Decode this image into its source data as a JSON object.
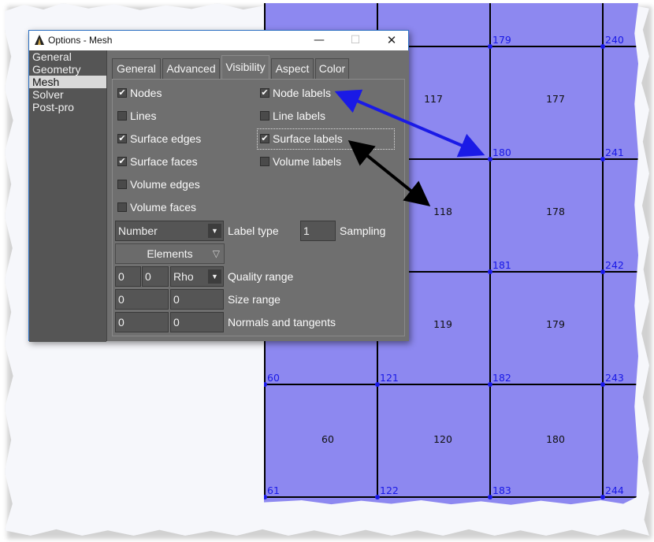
{
  "mesh": {
    "node_labels": [
      "179",
      "240",
      "180",
      "241",
      "181",
      "242",
      "60",
      "121",
      "182",
      "243",
      "61",
      "122",
      "183",
      "244"
    ],
    "element_labels": [
      "117",
      "177",
      "118",
      "178",
      "119",
      "179",
      "60",
      "120",
      "180"
    ],
    "node_color": "#1919e6",
    "face_color": "#8d88f0"
  },
  "dialog": {
    "title": "Options - Mesh",
    "title_icon": "gmsh-logo-icon",
    "controls": {
      "minimize": "—",
      "maximize": "☐",
      "close": "✕"
    },
    "categories": [
      "General",
      "Geometry",
      "Mesh",
      "Solver",
      "Post-pro"
    ],
    "selected_category": "Mesh",
    "tabs": [
      "General",
      "Advanced",
      "Visibility",
      "Aspect",
      "Color"
    ],
    "active_tab": "Visibility",
    "checkboxes": [
      {
        "label": "Nodes",
        "checked": true
      },
      {
        "label": "Lines",
        "checked": false
      },
      {
        "label": "Surface edges",
        "checked": true
      },
      {
        "label": "Surface faces",
        "checked": true
      },
      {
        "label": "Volume edges",
        "checked": false
      },
      {
        "label": "Volume faces",
        "checked": false
      },
      {
        "label": "Node labels",
        "checked": true
      },
      {
        "label": "Line labels",
        "checked": false
      },
      {
        "label": "Surface labels",
        "checked": true
      },
      {
        "label": "Volume labels",
        "checked": false
      }
    ],
    "label_type": {
      "value": "Number",
      "label": "Label type"
    },
    "sampling": {
      "value": "1",
      "label": "Sampling"
    },
    "elements_button": "Elements",
    "quality_range": {
      "min": "0",
      "max": "0",
      "measure": "Rho",
      "label": "Quality range"
    },
    "size_range": {
      "min": "0",
      "max": "0",
      "label": "Size range"
    },
    "normals": {
      "normals": "0",
      "tangents": "0",
      "label": "Normals and tangents"
    }
  },
  "annotations": {
    "arrow_colors": [
      "#1a1ae6",
      "#000000"
    ]
  }
}
